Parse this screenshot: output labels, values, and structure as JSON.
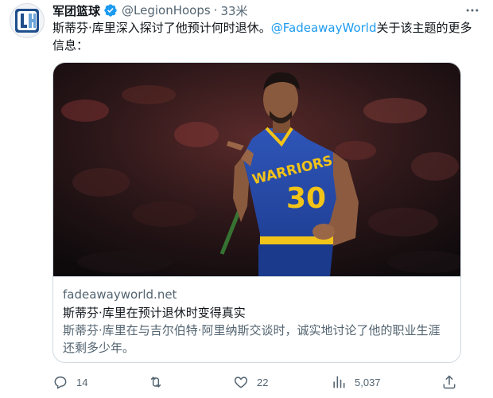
{
  "author": {
    "display_name": "军团篮球",
    "handle": "@LegionHoops",
    "separator": "·",
    "time": "33米",
    "avatar_initials": "LH"
  },
  "tweet": {
    "text_before": "斯蒂芬·库里深入探讨了他预计何时退休。",
    "mention": "@FadeawayWorld",
    "text_after": "关于该主题的更多信息："
  },
  "card": {
    "image_alt": "Stephen Curry pointing, Warriors #30 jersey",
    "jersey_text": "WARRIORS",
    "jersey_number": "30",
    "domain": "fadeawayworld.net",
    "title": "斯蒂芬·库里在预计退休时变得真实",
    "description": "斯蒂芬·库里在与吉尔伯特·阿里纳斯交谈时，诚实地讨论了他的职业生涯还剩多少年。"
  },
  "actions": {
    "reply_count": "14",
    "retweet_count": "",
    "like_count": "22",
    "views_count": "5,037"
  },
  "colors": {
    "accent": "#1d9bf0",
    "text": "#0f1419",
    "secondary": "#536471",
    "border": "#cfd9de"
  },
  "icons": [
    "verified-badge-icon",
    "more-icon",
    "reply-icon",
    "retweet-icon",
    "like-icon",
    "views-icon",
    "share-icon"
  ]
}
